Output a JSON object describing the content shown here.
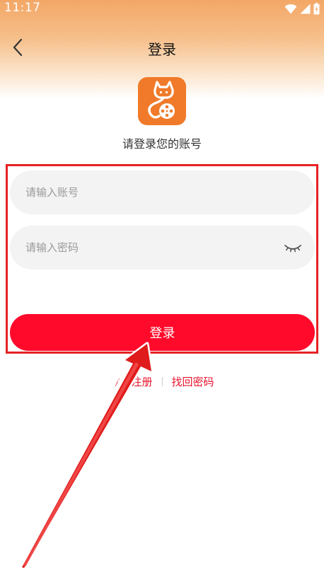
{
  "status_bar": {
    "time": "11:17",
    "icons": [
      "wifi-icon",
      "signal-icon",
      "battery-icon"
    ]
  },
  "header": {
    "back_icon": "chevron-left-icon",
    "title": "登录"
  },
  "logo": {
    "icon": "cat-film-reel-logo",
    "color": "#f07a29"
  },
  "subtitle": "请登录您的账号",
  "form": {
    "account": {
      "placeholder": "请输入账号",
      "value": ""
    },
    "password": {
      "placeholder": "请输入密码",
      "value": "",
      "toggle_icon": "eye-closed-icon"
    },
    "login_button": "登录"
  },
  "links": {
    "register": "立即注册",
    "forgot_password": "找回密码"
  },
  "colors": {
    "accent": "#ff0a2b",
    "link": "#e8152e",
    "annotation": "#e62222",
    "header_gradient_top": "#f3a766"
  },
  "annotations": {
    "highlight_box": "login-form",
    "arrow_target": "login-button"
  }
}
